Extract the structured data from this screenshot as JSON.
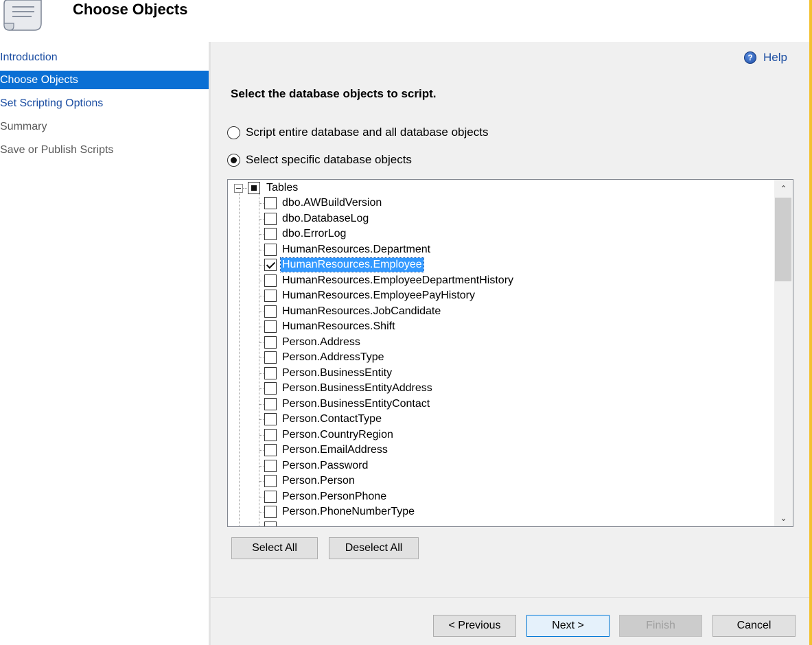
{
  "page": {
    "title": "Choose Objects"
  },
  "sidebar": {
    "items": [
      {
        "label": "Introduction",
        "state": "link"
      },
      {
        "label": "Choose Objects",
        "state": "active"
      },
      {
        "label": "Set Scripting Options",
        "state": "link"
      },
      {
        "label": "Summary",
        "state": "disabled"
      },
      {
        "label": "Save or Publish Scripts",
        "state": "disabled"
      }
    ]
  },
  "main": {
    "help_label": "Help",
    "help_icon": "help-question-icon",
    "section_title": "Select the database objects to script.",
    "radio_options": [
      {
        "label": "Script entire database and all database objects",
        "checked": false
      },
      {
        "label": "Select specific database objects",
        "checked": true
      }
    ],
    "tree": {
      "root": {
        "label": "Tables",
        "check_state": "partial",
        "expanded": true
      },
      "items": [
        {
          "label": "dbo.AWBuildVersion",
          "checked": false
        },
        {
          "label": "dbo.DatabaseLog",
          "checked": false
        },
        {
          "label": "dbo.ErrorLog",
          "checked": false
        },
        {
          "label": "HumanResources.Department",
          "checked": false
        },
        {
          "label": "HumanResources.Employee",
          "checked": true,
          "selected": true
        },
        {
          "label": "HumanResources.EmployeeDepartmentHistory",
          "checked": false
        },
        {
          "label": "HumanResources.EmployeePayHistory",
          "checked": false
        },
        {
          "label": "HumanResources.JobCandidate",
          "checked": false
        },
        {
          "label": "HumanResources.Shift",
          "checked": false
        },
        {
          "label": "Person.Address",
          "checked": false
        },
        {
          "label": "Person.AddressType",
          "checked": false
        },
        {
          "label": "Person.BusinessEntity",
          "checked": false
        },
        {
          "label": "Person.BusinessEntityAddress",
          "checked": false
        },
        {
          "label": "Person.BusinessEntityContact",
          "checked": false
        },
        {
          "label": "Person.ContactType",
          "checked": false
        },
        {
          "label": "Person.CountryRegion",
          "checked": false
        },
        {
          "label": "Person.EmailAddress",
          "checked": false
        },
        {
          "label": "Person.Password",
          "checked": false
        },
        {
          "label": "Person.Person",
          "checked": false
        },
        {
          "label": "Person.PersonPhone",
          "checked": false
        },
        {
          "label": "Person.PhoneNumberType",
          "checked": false
        },
        {
          "label": "",
          "checked": false
        }
      ]
    },
    "select_all_label": "Select All",
    "deselect_all_label": "Deselect All"
  },
  "footer": {
    "previous_label": "< Previous",
    "next_label": "Next >",
    "finish_label": "Finish",
    "cancel_label": "Cancel"
  },
  "colors": {
    "accent": "#0a6fd4",
    "selection": "#3399ff",
    "link": "#1c4ea2",
    "panel": "#f0f0f0",
    "window_edge": "#f3c12f"
  }
}
